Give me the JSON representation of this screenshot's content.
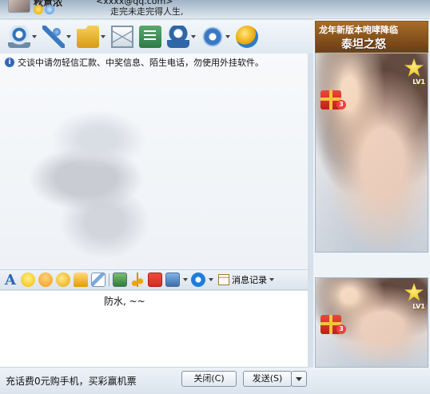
{
  "header": {
    "name": "秋意浓",
    "email": "<xxxx@qq.com>",
    "signature": "走完未走完得人生,"
  },
  "toolbar": {
    "items": [
      {
        "icon": "video-camera-icon"
      },
      {
        "icon": "microphone-icon"
      },
      {
        "icon": "folder-transfer-icon"
      },
      {
        "icon": "mail-icon"
      },
      {
        "icon": "document-icon"
      },
      {
        "icon": "group-icon"
      },
      {
        "icon": "settings-icon"
      },
      {
        "icon": "globe-icon"
      }
    ]
  },
  "chat": {
    "warning": "交谈中请勿轻信汇款、中奖信息、陌生电话，勿使用外挂软件。"
  },
  "format_bar": {
    "font_label": "A",
    "record_label": "消息记录"
  },
  "input": {
    "text": "防水, ~~"
  },
  "bottom": {
    "promo": "充话费0元购手机，买彩赢机票",
    "close_label": "关闭(C)",
    "send_label": "发送(S)"
  },
  "ads": {
    "top_line1": "龙年新版本咆哮降临",
    "top_line2": "泰坦之怒",
    "level_text": "LV1",
    "gift_count": "3"
  }
}
